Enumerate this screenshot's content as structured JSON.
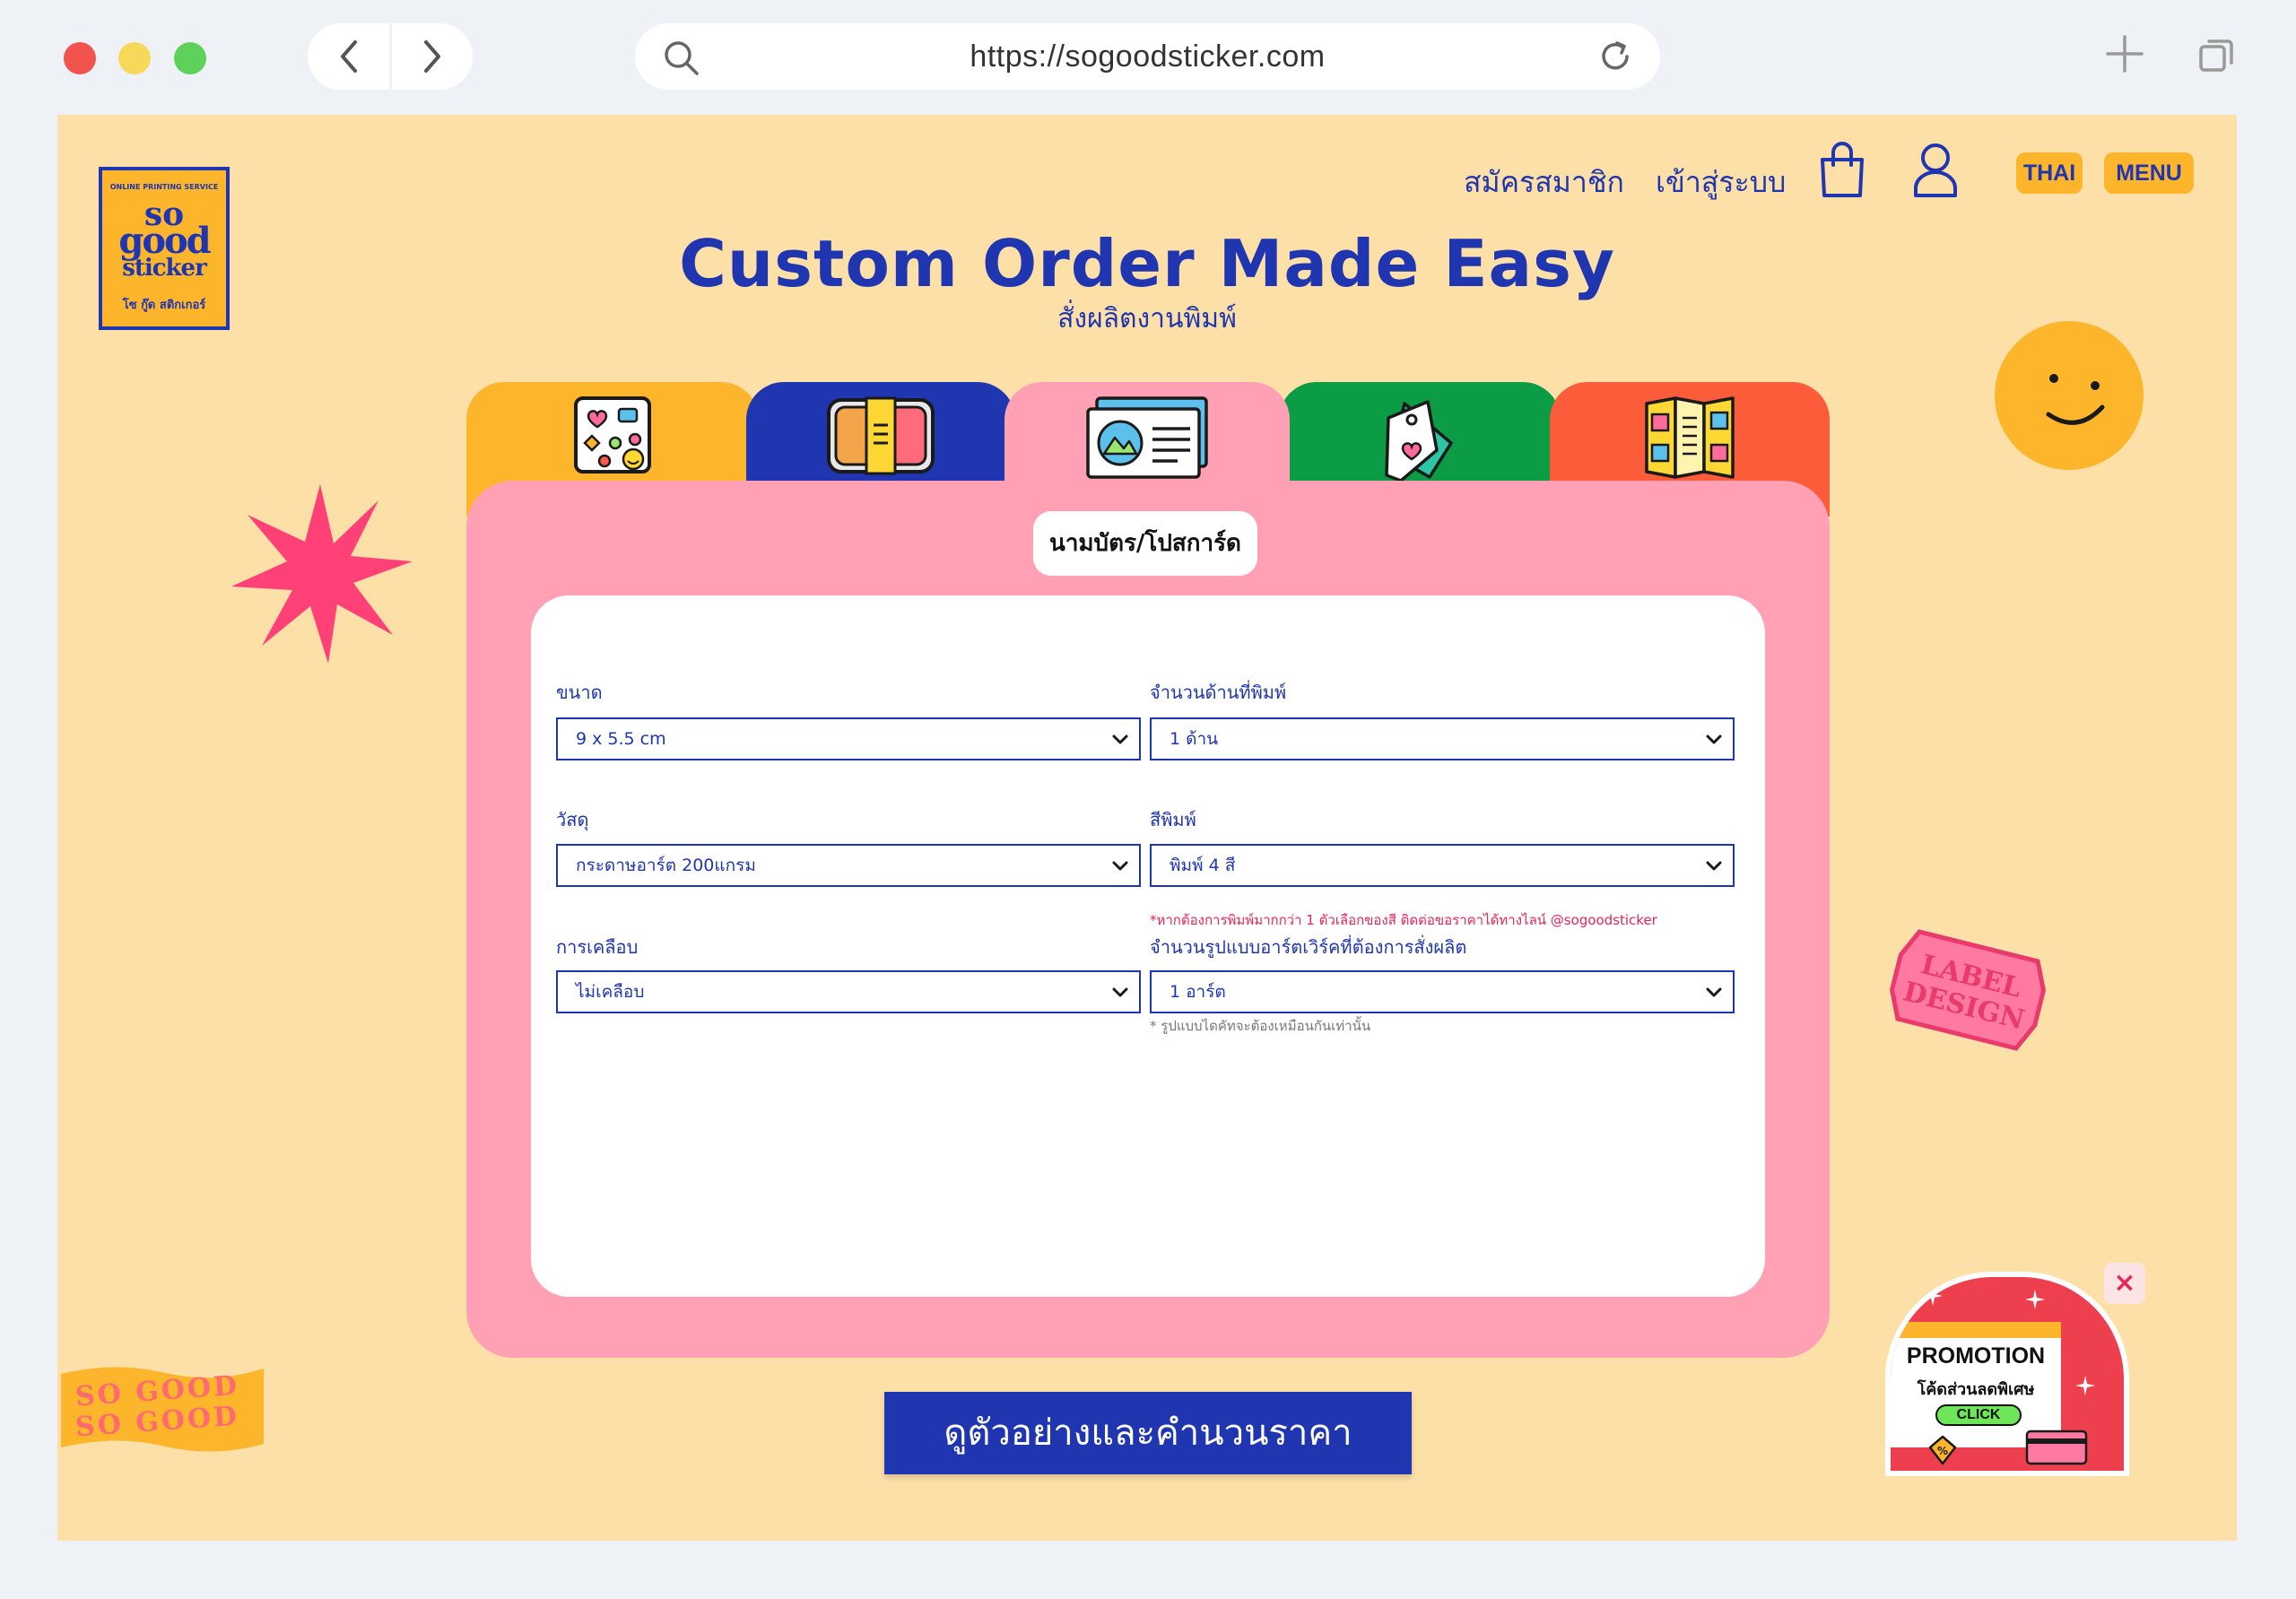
{
  "browser": {
    "url": "https://sogoodsticker.com"
  },
  "header": {
    "logo": {
      "top_arc": "ONLINE PRINTING SERVICE",
      "line1": "so",
      "line2": "good",
      "line3": "sticker",
      "thai": "โซ กู๊ด สติกเกอร์"
    },
    "register": "สมัครสมาชิก",
    "login": "เข้าสู่ระบบ",
    "lang": "THAI",
    "menu": "MENU"
  },
  "hero": {
    "title": "Custom Order Made Easy",
    "subtitle": "สั่งผลิตงานพิมพ์"
  },
  "tabs": [
    {
      "icon": "sticker-sheet-icon",
      "color": "#fdb52c"
    },
    {
      "icon": "food-box-icon",
      "color": "#1f36b0"
    },
    {
      "icon": "business-card-icon",
      "color": "#ffa0b4",
      "active": true
    },
    {
      "icon": "hang-tag-icon",
      "color": "#0c9c45"
    },
    {
      "icon": "folded-brochure-icon",
      "color": "#fd5c3a"
    }
  ],
  "card": {
    "label": "นามบัตร/โปสการ์ด"
  },
  "form": {
    "size": {
      "label": "ขนาด",
      "value": "9 x 5.5 cm"
    },
    "sides": {
      "label": "จำนวนด้านที่พิมพ์",
      "value": "1 ด้าน"
    },
    "material": {
      "label": "วัสดุ",
      "value": "กระดาษอาร์ต 200แกรม"
    },
    "color": {
      "label": "สีพิมพ์",
      "value": "พิมพ์ 4 สี"
    },
    "color_note": "*หากต้องการพิมพ์มากกว่า 1 ตัวเลือกของสี ติดต่อขอราคาได้ทางไลน์ @sogoodsticker",
    "coating": {
      "label": "การเคลือบ",
      "value": "ไม่เคลือบ"
    },
    "artwork": {
      "label": "จำนวนรูปแบบอาร์ตเวิร์คที่ต้องการสั่งผลิต",
      "value": "1 อาร์ต"
    },
    "artwork_note": "* รูปแบบไดคัทจะต้องเหมือนกันเท่านั้น"
  },
  "cta": "ดูตัวอย่างและคำนวนราคา",
  "decor": {
    "label_sticker": [
      "LABEL",
      "DESIGN"
    ],
    "flag_lines": [
      "SO GOOD",
      "SO GOOD"
    ]
  },
  "promo": {
    "title": "PROMOTION",
    "subtitle": "โค้ดส่วนลดพิเศษ",
    "click": "CLICK",
    "close": "×"
  },
  "colors": {
    "page_bg": "#fde0a8",
    "brand_blue": "#1f36b0",
    "yellow": "#fdb52c",
    "pink": "#ffa0b4",
    "green": "#0c9c45",
    "orange": "#fd5c3a",
    "hot_pink": "#ff4178"
  }
}
